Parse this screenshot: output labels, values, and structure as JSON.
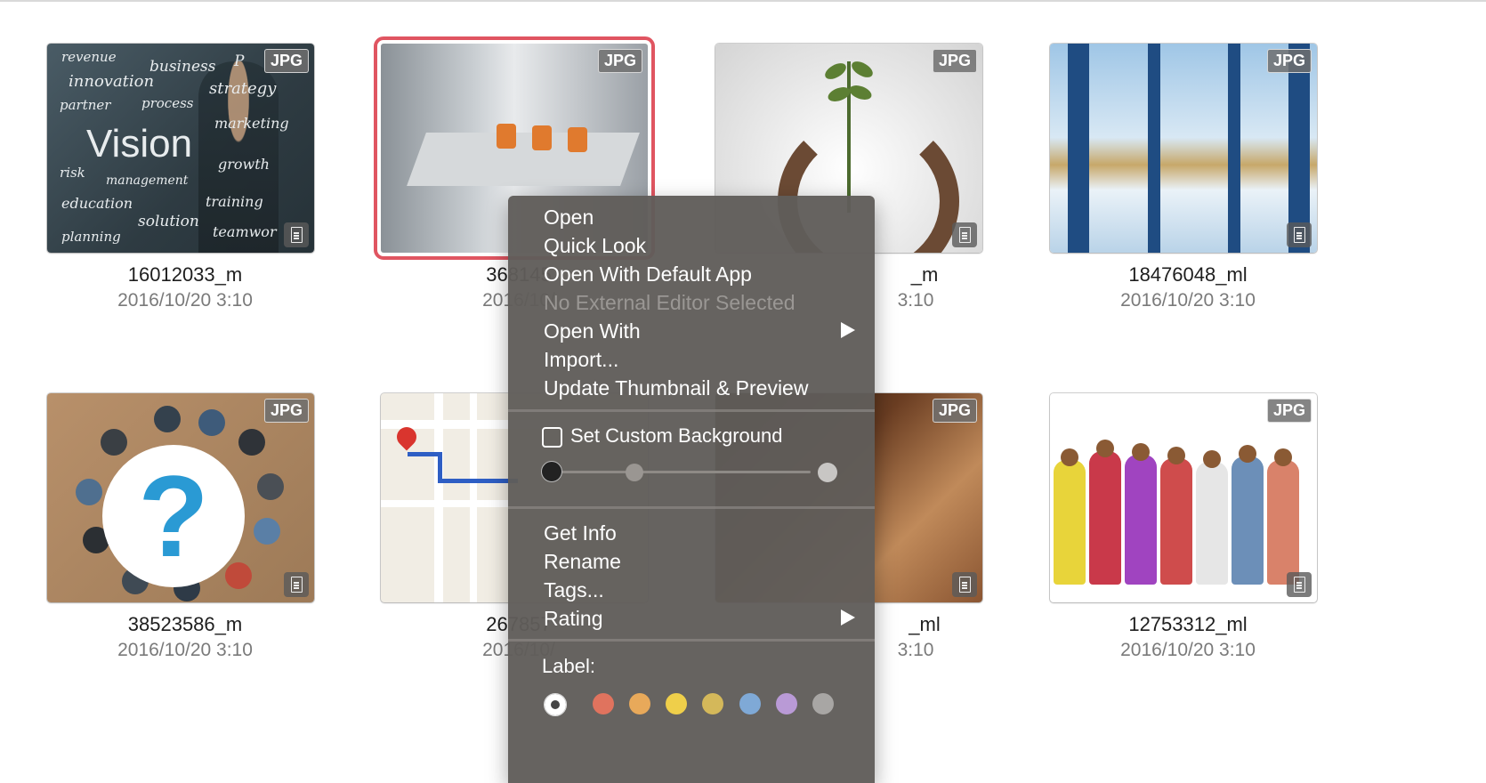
{
  "badge_text": "JPG",
  "tiles": [
    {
      "name": "16012033_m",
      "date": "2016/10/20 3:10"
    },
    {
      "name": "368145",
      "date": "2016/10/"
    },
    {
      "name": "_m",
      "date": "3:10"
    },
    {
      "name": "18476048_ml",
      "date": "2016/10/20 3:10"
    },
    {
      "name": "38523586_m",
      "date": "2016/10/20 3:10"
    },
    {
      "name": "267857",
      "date": "2016/10/"
    },
    {
      "name": "_ml",
      "date": "3:10"
    },
    {
      "name": "12753312_ml",
      "date": "2016/10/20 3:10"
    }
  ],
  "vision_words": [
    "revenue",
    "business",
    "P",
    "innovation",
    "strategy",
    "partner",
    "process",
    "marketing",
    "Vision",
    "risk",
    "management",
    "growth",
    "education",
    "training",
    "solution",
    "teamwor",
    "planning"
  ],
  "selection_color": "#e05561",
  "context_menu": {
    "items_1": [
      "Open",
      "Quick Look",
      "Open With Default App",
      "No External Editor Selected",
      "Open With",
      "Import...",
      "Update Thumbnail & Preview"
    ],
    "set_custom_background": "Set Custom Background",
    "items_2": [
      "Get Info",
      "Rename",
      "Tags...",
      "Rating"
    ],
    "label_title": "Label:",
    "label_colors": [
      "#ffffff",
      "#e0735e",
      "#e8a95a",
      "#efcf4a",
      "#d4b85a",
      "#7fa9d6",
      "#b99ad6",
      "#a8a6a4"
    ]
  }
}
